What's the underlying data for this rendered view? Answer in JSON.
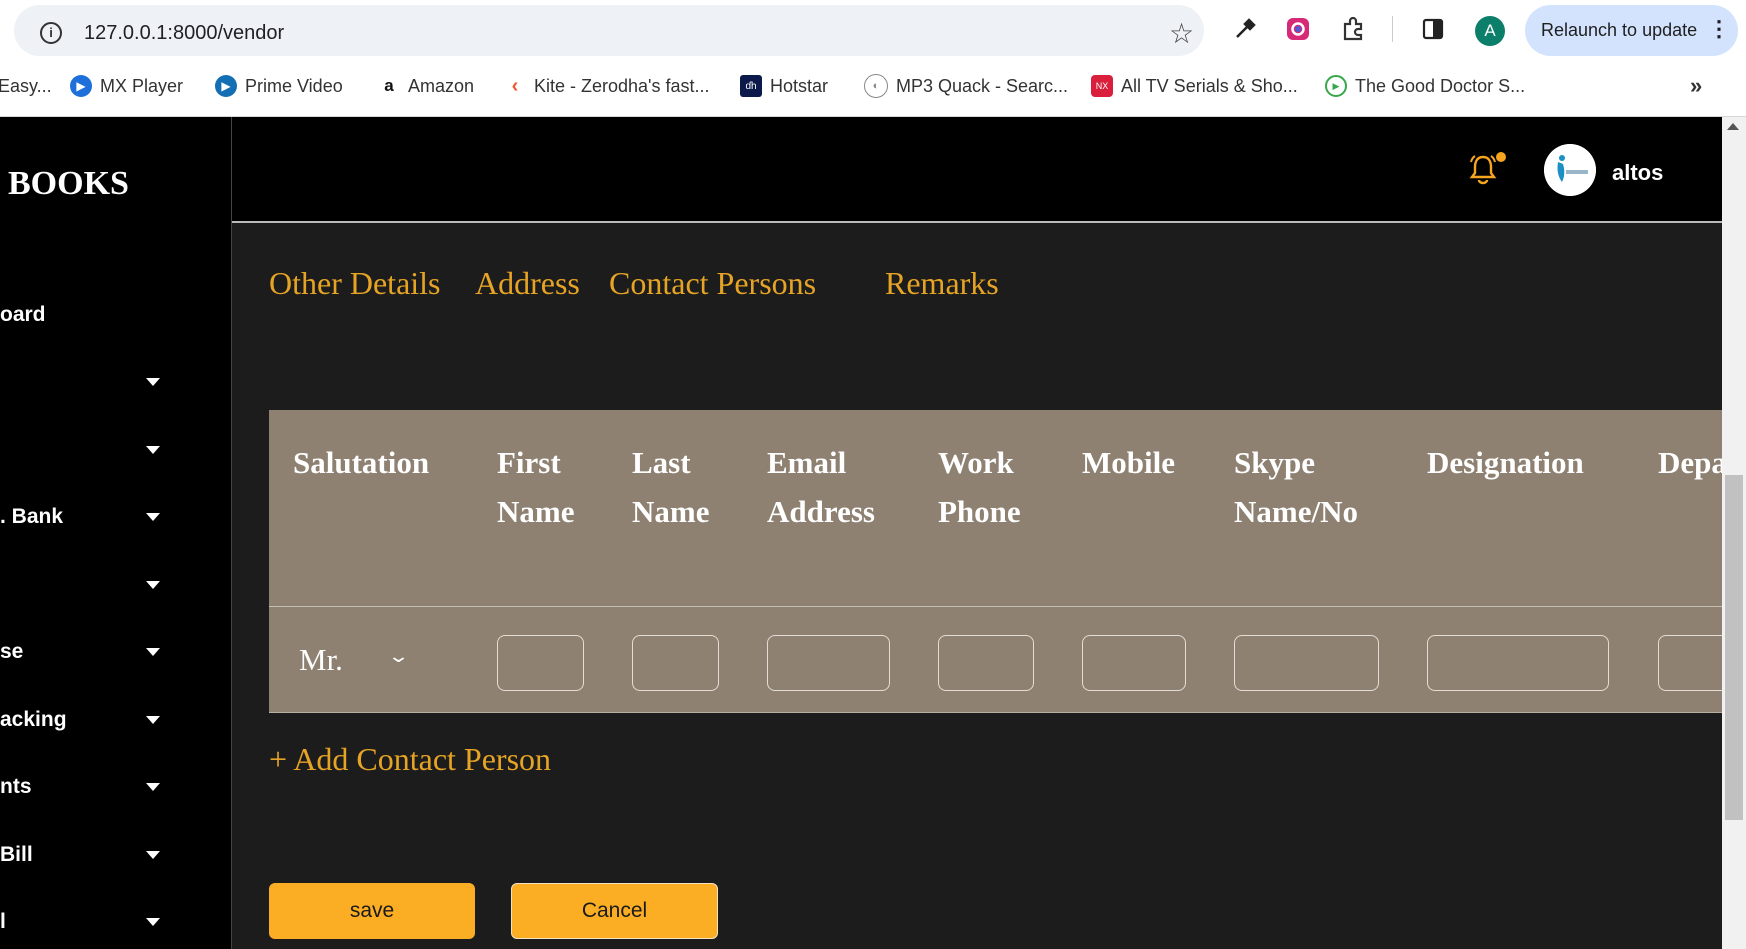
{
  "browser": {
    "url": "127.0.0.1:8000/vendor",
    "relaunch_label": "Relaunch to update",
    "profile_initial": "A",
    "bookmarks": [
      {
        "label": "Easy..."
      },
      {
        "label": "MX Player",
        "color": "#1e6fd9"
      },
      {
        "label": "Prime Video",
        "color": "#146eb4"
      },
      {
        "label": "Amazon",
        "color": "#111111"
      },
      {
        "label": "Kite - Zerodha's fast...",
        "color": "#f2522e"
      },
      {
        "label": "Hotstar",
        "color": "#0c1a4b"
      },
      {
        "label": "MP3 Quack - Searc...",
        "color": "#888888"
      },
      {
        "label": "All TV Serials & Sho...",
        "color": "#d91f3c"
      },
      {
        "label": "The Good Doctor S...",
        "color": "#36a84a"
      }
    ]
  },
  "sidebar": {
    "brand": "BOOKS",
    "items": [
      {
        "label": "oard"
      },
      {
        "label": ""
      },
      {
        "label": ""
      },
      {
        "label": ". Bank"
      },
      {
        "label": ""
      },
      {
        "label": "se"
      },
      {
        "label": "acking"
      },
      {
        "label": "nts"
      },
      {
        "label": "Bill"
      },
      {
        "label": "l"
      }
    ]
  },
  "header": {
    "user_name": "altos",
    "notification_color": "#f6a61e"
  },
  "tabs": [
    "Other Details",
    "Address",
    "Contact Persons",
    "Remarks"
  ],
  "contact_table": {
    "headers": [
      "Salutation",
      "First\nName",
      "Last\nName",
      "Email\nAddress",
      "Work\nPhone",
      "Mobile",
      "Skype\nName/No",
      "Designation",
      "Depa"
    ],
    "salutation_value": "Mr."
  },
  "add_contact_label": "+ Add Contact Person",
  "buttons": {
    "save": "save",
    "cancel": "Cancel"
  },
  "colors": {
    "accent": "#e6a425",
    "button": "#fbae24",
    "table_bg": "#8e8172",
    "main_bg": "#1c1c1c"
  }
}
